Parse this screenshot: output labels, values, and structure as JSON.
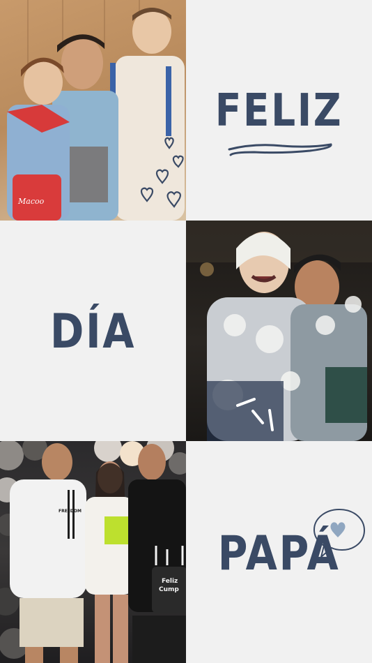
{
  "words": {
    "feliz": "FELIZ",
    "dia": "DÍA",
    "papa": "PAPÁ"
  },
  "photo1": {
    "bag_text": "Macoo",
    "icons": [
      "heart-icon",
      "heart-icon",
      "heart-icon",
      "heart-icon",
      "heart-icon"
    ]
  },
  "photo2": {
    "icons": [
      "sparkle-lines-icon"
    ]
  },
  "photo3": {
    "shirt_text": "FREEDOM",
    "cake_text_line1": "Feliz",
    "cake_text_line2": "Cump"
  },
  "decorations": [
    "squiggle-underline-icon",
    "speech-bubble-heart-icon"
  ],
  "colors": {
    "text": "#3a4a65",
    "background": "#f1f1f1",
    "accent_light": "#8fa6c0"
  }
}
